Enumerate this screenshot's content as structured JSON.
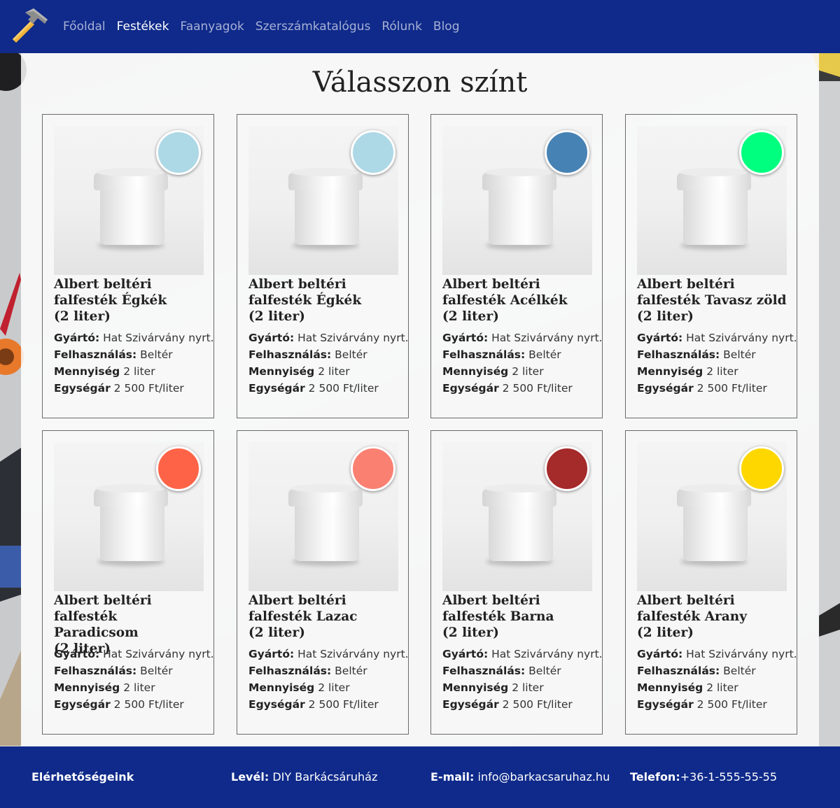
{
  "header": {
    "nav": [
      {
        "label": "Főoldal",
        "active": false
      },
      {
        "label": "Festékek",
        "active": true
      },
      {
        "label": "Faanyagok",
        "active": false
      },
      {
        "label": "Szerszámkatalógus",
        "active": false
      },
      {
        "label": "Rólunk",
        "active": false
      },
      {
        "label": "Blog",
        "active": false
      }
    ]
  },
  "main": {
    "title": "Válasszon színt",
    "spec_labels": {
      "maker": "Gyártó:",
      "usage": "Felhasználás:",
      "quantity": "Mennyiség",
      "unit_price": "Egységár"
    },
    "products": [
      {
        "name_line1": "Albert beltéri",
        "name_line2": "falfesték Égkék",
        "name_line3": "(2 liter)",
        "color": "#add8e6",
        "maker": "Hat Szivárvány nyrt.",
        "usage": "Beltér",
        "quantity": "2 liter",
        "unit_price": "2 500 Ft/liter"
      },
      {
        "name_line1": "Albert beltéri",
        "name_line2": "falfesték Égkék",
        "name_line3": "(2 liter)",
        "color": "#add8e6",
        "maker": "Hat Szivárvány nyrt.",
        "usage": "Beltér",
        "quantity": "2 liter",
        "unit_price": "2 500 Ft/liter"
      },
      {
        "name_line1": "Albert beltéri",
        "name_line2": "falfesték Acélkék",
        "name_line3": "(2 liter)",
        "color": "#4682b4",
        "maker": "Hat Szivárvány nyrt.",
        "usage": "Beltér",
        "quantity": "2 liter",
        "unit_price": "2 500 Ft/liter"
      },
      {
        "name_line1": "Albert beltéri",
        "name_line2": "falfesték Tavasz zöld",
        "name_line3": "(2 liter)",
        "color": "#00ff7f",
        "maker": "Hat Szivárvány nyrt.",
        "usage": "Beltér",
        "quantity": "2 liter",
        "unit_price": "2 500 Ft/liter"
      },
      {
        "name_line1": "Albert beltéri",
        "name_line2": "falfesték Paradicsom",
        "name_line3": "(2 liter)",
        "color": "#ff6347",
        "maker": "Hat Szivárvány nyrt.",
        "usage": "Beltér",
        "quantity": "2 liter",
        "unit_price": "2 500 Ft/liter"
      },
      {
        "name_line1": "Albert beltéri",
        "name_line2": "falfesték Lazac",
        "name_line3": "(2 liter)",
        "color": "#fa8072",
        "maker": "Hat Szivárvány nyrt.",
        "usage": "Beltér",
        "quantity": "2 liter",
        "unit_price": "2 500 Ft/liter"
      },
      {
        "name_line1": "Albert beltéri",
        "name_line2": "falfesték Barna",
        "name_line3": "(2 liter)",
        "color": "#a52a2a",
        "maker": "Hat Szivárvány nyrt.",
        "usage": "Beltér",
        "quantity": "2 liter",
        "unit_price": "2 500 Ft/liter"
      },
      {
        "name_line1": "Albert beltéri",
        "name_line2": "falfesték Arany",
        "name_line3": "(2 liter)",
        "color": "#ffd700",
        "maker": "Hat Szivárvány nyrt.",
        "usage": "Beltér",
        "quantity": "2 liter",
        "unit_price": "2 500 Ft/liter"
      }
    ]
  },
  "footer": {
    "heading": "Elérhetőségeink",
    "mail_label": "Levél:",
    "mail_value": "DIY Barkácsáruház",
    "email_label": "E-mail:",
    "email_value": "info@barkacsaruhaz.hu",
    "phone_label": "Telefon:",
    "phone_value": "+36-1-555-55-55"
  },
  "colors": {
    "brand": "#0f2a8a",
    "nav_inactive": "#a7b0d6",
    "nav_active": "#ffffff"
  },
  "icons": [
    "hammer-logo-icon",
    "paint-bucket-image"
  ]
}
